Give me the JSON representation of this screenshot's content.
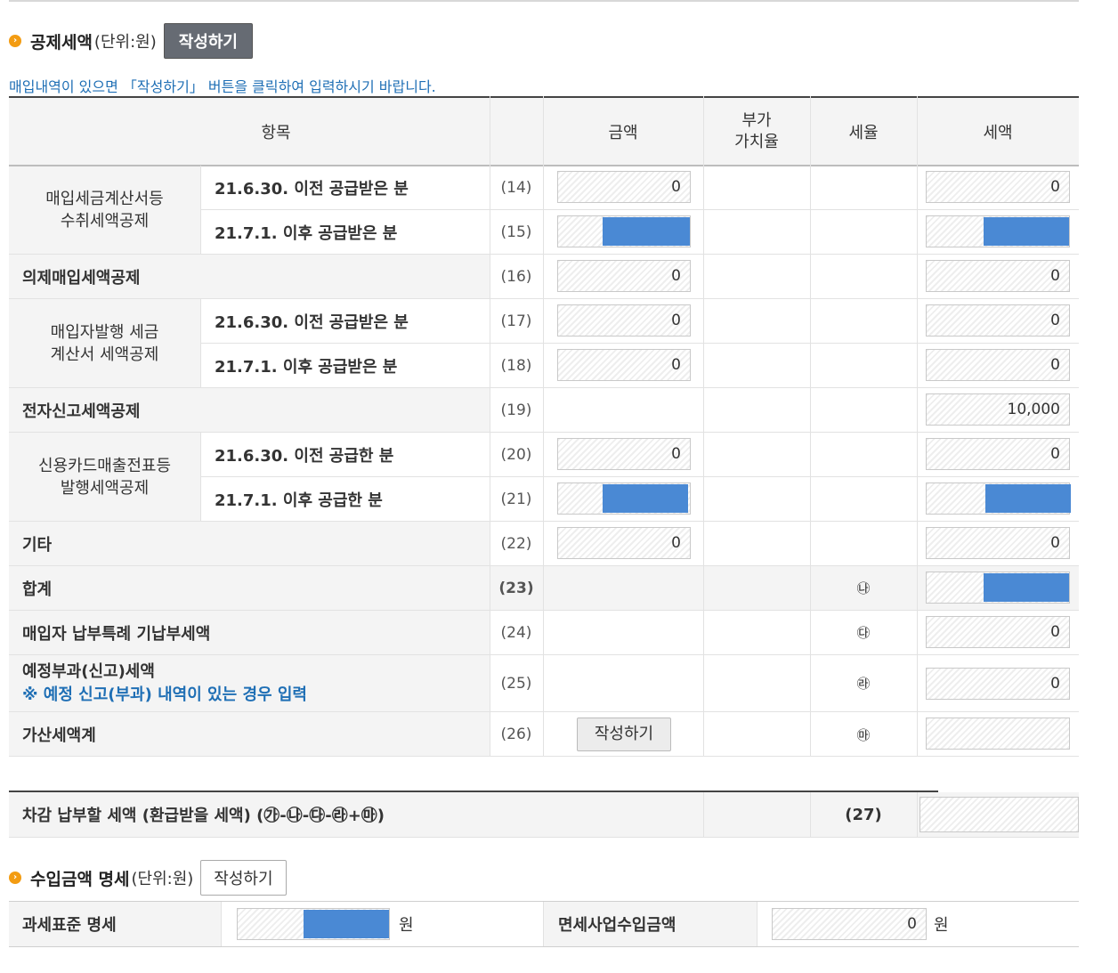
{
  "deduction_section": {
    "title": "공제세액",
    "unit": "(단위:원)",
    "write_button": "작성하기",
    "notice": "매입내역이 있으면 「작성하기」 버튼을 클릭하여 입력하시기 바랍니다."
  },
  "table": {
    "headers": {
      "item": "항목",
      "amount": "금액",
      "vat_rate": "부가\n가치율",
      "tax_rate": "세율",
      "tax": "세액"
    },
    "groups": {
      "g1": "매입세금계산서등\n수취세액공제",
      "g2": "매입자발행 세금\n계산서 세액공제",
      "g3": "신용카드매출전표등\n발행세액공제"
    },
    "rows": [
      {
        "label": "21.6.30. 이전 공급받은 분",
        "num": "(14)",
        "amount": "0",
        "tax": "0"
      },
      {
        "label": "21.7.1. 이후 공급받은 분",
        "num": "(15)",
        "amount_fill": 1.0,
        "tax_fill": 1.0
      },
      {
        "label": "의제매입세액공제",
        "num": "(16)",
        "amount": "0",
        "tax": "0"
      },
      {
        "label": "21.6.30. 이전 공급받은 분",
        "num": "(17)",
        "amount": "0",
        "tax": "0"
      },
      {
        "label": "21.7.1. 이후 공급받은 분",
        "num": "(18)",
        "amount": "0",
        "tax": "0"
      },
      {
        "label": "전자신고세액공제",
        "num": "(19)",
        "tax": "10,000"
      },
      {
        "label": "21.6.30. 이전 공급한 분",
        "num": "(20)",
        "amount": "0",
        "tax": "0"
      },
      {
        "label": "21.7.1. 이후 공급한 분",
        "num": "(21)",
        "amount_fill": 1.0,
        "tax_fill": 1.0
      },
      {
        "label": "기타",
        "num": "(22)",
        "amount": "0",
        "tax": "0"
      },
      {
        "label": "합계",
        "num": "(23)",
        "rate_mark": "㉯",
        "tax_fill": 1.0
      },
      {
        "label": "매입자 납부특례 기납부세액",
        "num": "(24)",
        "rate_mark": "㉰",
        "tax": "0"
      },
      {
        "label": "예정부과(신고)세액",
        "sub_label": "※ 예정 신고(부과) 내역이 있는 경우 입력",
        "num": "(25)",
        "rate_mark": "㉱",
        "tax": "0"
      },
      {
        "label": "가산세액계",
        "num": "(26)",
        "write_button": "작성하기",
        "rate_mark": "㉲",
        "tax": ""
      }
    ]
  },
  "final": {
    "label": "차감 납부할 세액 (환급받을 세액) (㉮-㉯-㉰-㉱+㉲)",
    "num": "(27)"
  },
  "income_section": {
    "title": "수입금액 명세",
    "unit": "(단위:원)",
    "write_button": "작성하기",
    "tax_base_label": "과세표준 명세",
    "tax_base_fill": 1.0,
    "won1": "원",
    "exempt_label": "면세사업수입금액",
    "exempt_value": "0",
    "won2": "원"
  },
  "colors": {
    "accent_fill": "#4a89d4",
    "notice_blue": "#1f6fb5",
    "bullet": "#f39c12"
  }
}
